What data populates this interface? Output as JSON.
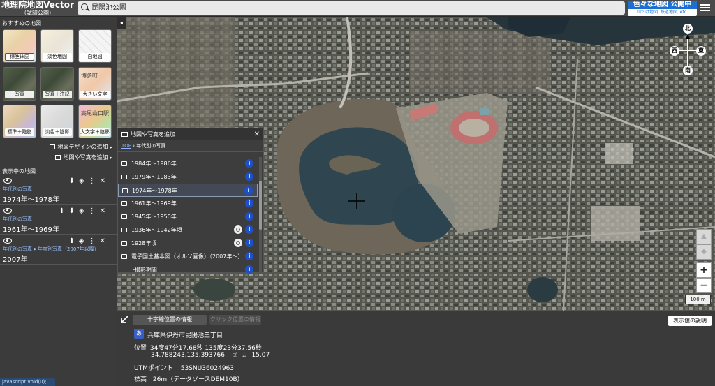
{
  "header": {
    "title": "地理院地図Vector",
    "subtitle": "（試験公開）",
    "search_value": "昆陽池公園",
    "promo_main": "色々な地図 公開中",
    "promo_sub": "川だけ地図, 鉄道地図, etc."
  },
  "sidebar": {
    "recommended_heading": "おすすめの地図",
    "tiles": [
      {
        "label": "標準地図",
        "selected": true
      },
      {
        "label": "淡色地図"
      },
      {
        "label": "白地図"
      },
      {
        "label": "写真"
      },
      {
        "label": "写真＋注記"
      },
      {
        "label": "大きい文字",
        "overlay": "博多町"
      },
      {
        "label": "標準＋陰影"
      },
      {
        "label": "淡色＋陰影"
      },
      {
        "label": "大文字＋陰影",
        "overlay": "高尾山口駅"
      }
    ],
    "design_link": "地図デザインの追加",
    "add_link": "地図や写真を追加",
    "layers_heading": "表示中の地図",
    "layers": [
      {
        "category": "年代別の写真",
        "name": "1974年〜1978年"
      },
      {
        "category": "年代別の写真",
        "name": "1961年〜1969年"
      },
      {
        "category": "年代別の写真 ▸ 年度別写真（2007年以降）",
        "name": "2007年"
      }
    ]
  },
  "dialog": {
    "title": "地図や写真を追加",
    "breadcrumb_top": "TOP",
    "breadcrumb_current": "年代別の写真",
    "items": [
      {
        "label": "1984年〜1986年"
      },
      {
        "label": "1979年〜1983年"
      },
      {
        "label": "1974年〜1978年",
        "selected": true
      },
      {
        "label": "1961年〜1969年"
      },
      {
        "label": "1945年〜1950年"
      },
      {
        "label": "1936年〜1942年頃",
        "zoom": true
      },
      {
        "label": "1928年頃",
        "zoom": true
      },
      {
        "label": "電子国土基本図（オルソ画像）（2007年〜）"
      },
      {
        "label": "└撮影期間"
      }
    ]
  },
  "map": {
    "compass": {
      "n": "北",
      "s": "南",
      "e": "東",
      "w": "西"
    },
    "scale": "100 m"
  },
  "info": {
    "tab_active": "十字線位置の情報",
    "tab_inactive": "クリック位置の情報",
    "explain_button": "表示値の説明",
    "address_badge": "あ",
    "address": "兵庫県伊丹市昆陽池三丁目",
    "pos_label": "位置",
    "pos_dms": "34度47分17.68秒 135度23分37.56秒",
    "pos_dec": "34.788243,135.393766",
    "zoom_label": "ズーム",
    "zoom_value": "15.07",
    "utm_label": "UTMポイント",
    "utm_value": "53SNU36024963",
    "elev_label": "標高",
    "elev_value": "26m（データソースDEM10B）"
  },
  "status_bar": "javascript:void(0);"
}
